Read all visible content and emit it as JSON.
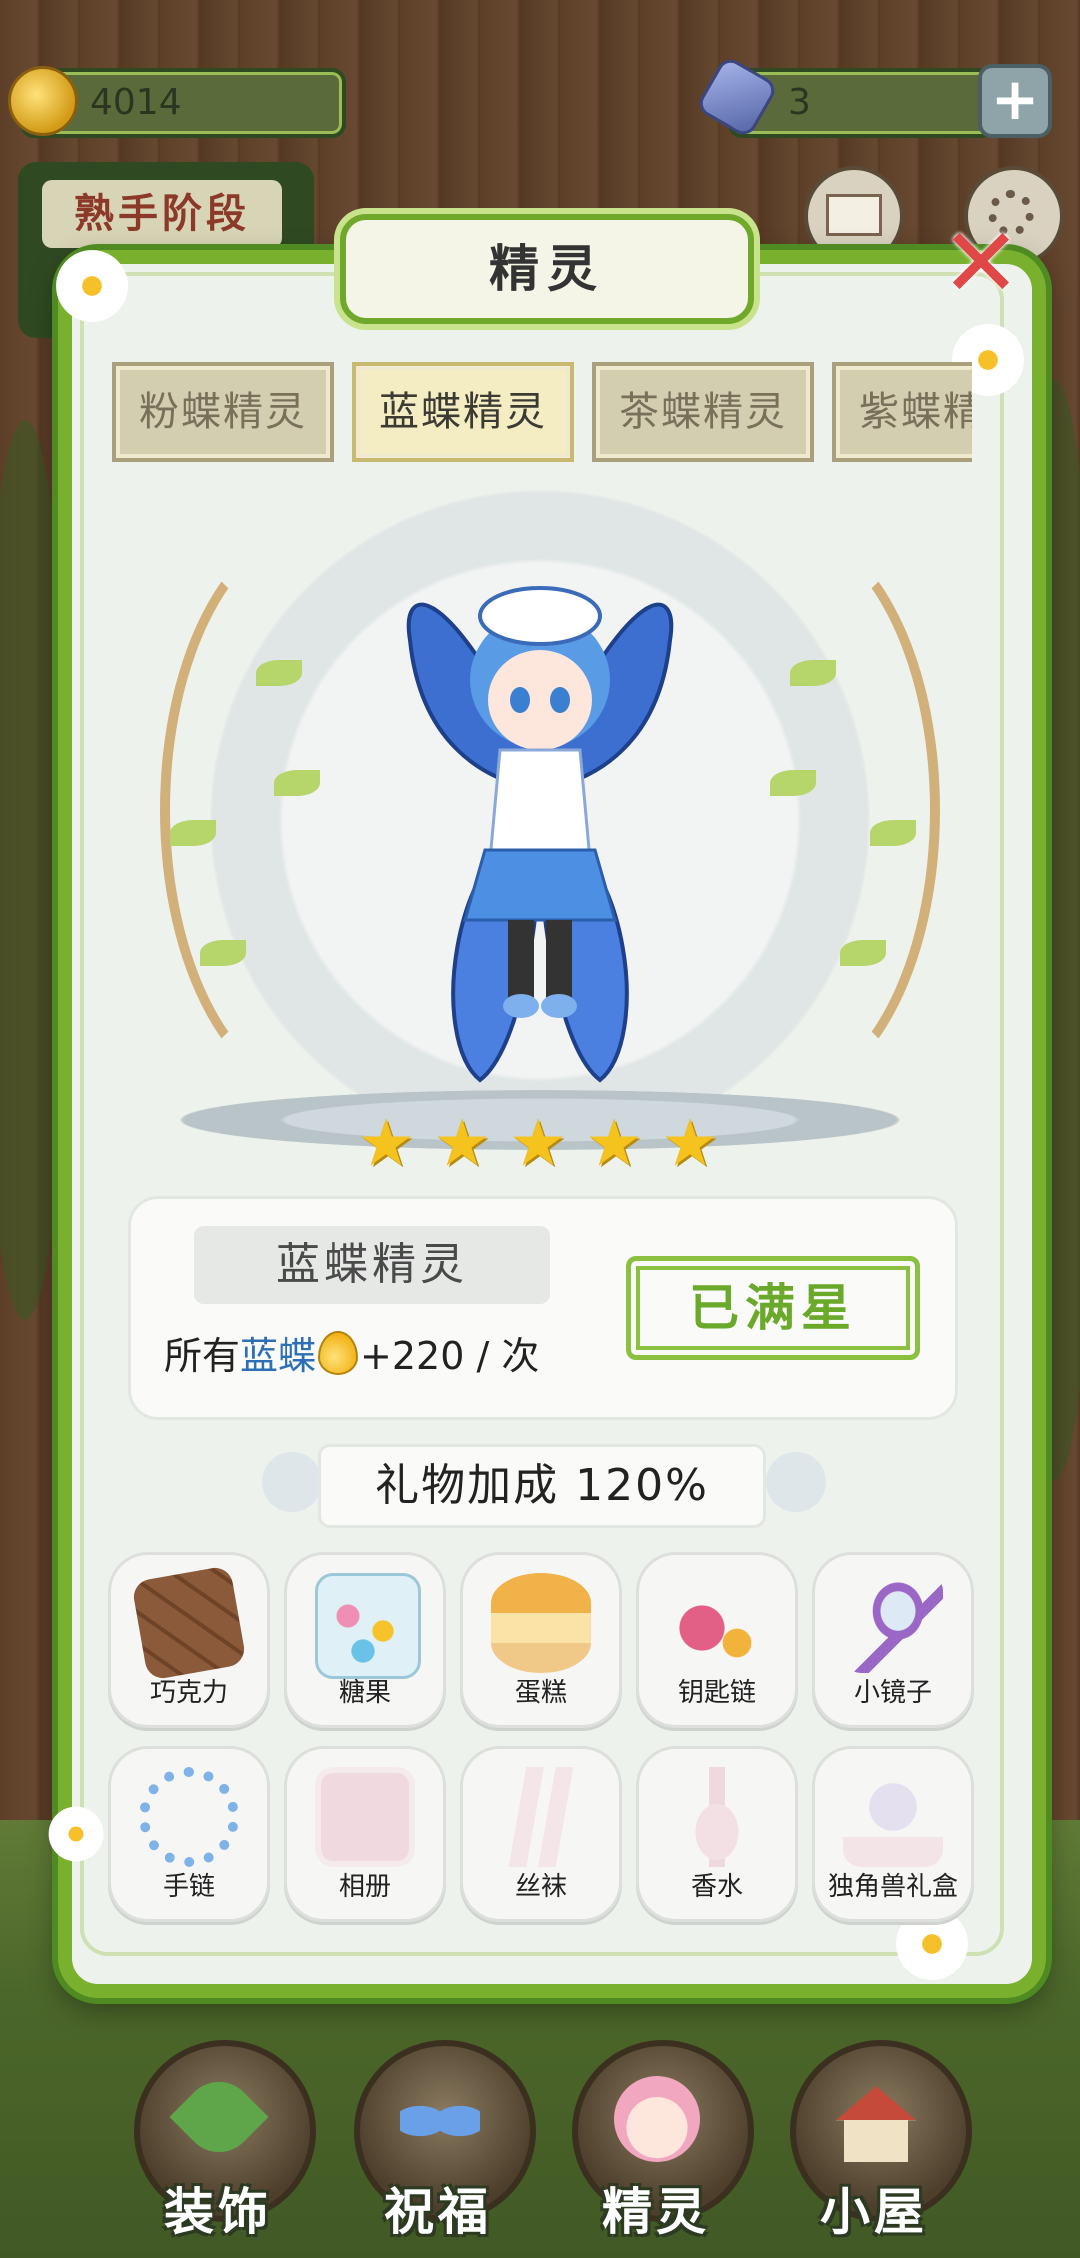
{
  "hud": {
    "coins": "4014",
    "gems": "3",
    "plus_label": "+",
    "stage_label": "熟手阶段"
  },
  "modal": {
    "title": "精灵",
    "close_label": "✕",
    "tabs": [
      {
        "label": "粉蝶精灵",
        "active": false
      },
      {
        "label": "蓝蝶精灵",
        "active": true
      },
      {
        "label": "茶蝶精灵",
        "active": false
      },
      {
        "label": "紫蝶精灵",
        "active": false
      }
    ],
    "stars": 5,
    "star_glyph": "★",
    "info": {
      "name": "蓝蝶精灵",
      "bonus_prefix": "所有",
      "bonus_target": "蓝蝶",
      "bonus_value": "+220",
      "bonus_suffix": " / 次",
      "maxed_label": "已满星"
    },
    "gift_bonus": "礼物加成 120%",
    "gifts": [
      {
        "label": "巧克力",
        "owned": true,
        "icon": "chocolate-icon",
        "color": "#8a5a3a"
      },
      {
        "label": "糖果",
        "owned": true,
        "icon": "candy-jar-icon",
        "color": "#ef8fb6"
      },
      {
        "label": "蛋糕",
        "owned": true,
        "icon": "cake-icon",
        "color": "#f2b24a"
      },
      {
        "label": "钥匙链",
        "owned": true,
        "icon": "keychain-icon",
        "color": "#e25f86"
      },
      {
        "label": "小镜子",
        "owned": true,
        "icon": "mirror-icon",
        "color": "#9b67c7"
      },
      {
        "label": "手链",
        "owned": true,
        "icon": "bracelet-icon",
        "color": "#7fb2e8"
      },
      {
        "label": "相册",
        "owned": false,
        "icon": "photo-album-icon",
        "color": "#e7a7b7"
      },
      {
        "label": "丝袜",
        "owned": false,
        "icon": "stockings-icon",
        "color": "#f0c4cf"
      },
      {
        "label": "香水",
        "owned": false,
        "icon": "perfume-icon",
        "color": "#f0b6c6"
      },
      {
        "label": "独角兽礼盒",
        "owned": false,
        "icon": "unicorn-box-icon",
        "color": "#c7b7e8"
      }
    ]
  },
  "nav": [
    {
      "label": "装饰",
      "icon": "plant-icon"
    },
    {
      "label": "祝福",
      "icon": "butterfly-icon"
    },
    {
      "label": "精灵",
      "icon": "fairy-icon"
    },
    {
      "label": "小屋",
      "icon": "house-icon"
    }
  ]
}
